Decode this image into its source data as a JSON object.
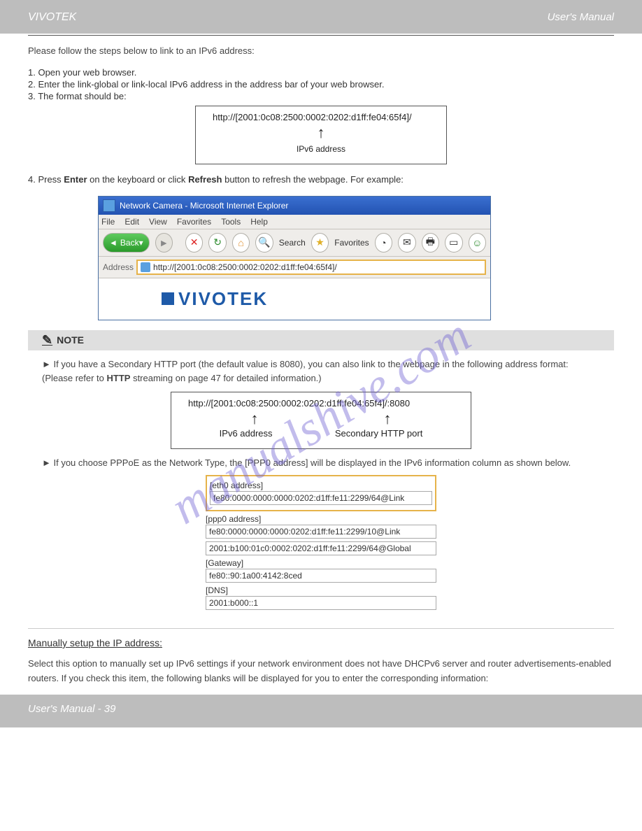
{
  "header": {
    "left": "VIVOTEK",
    "right": "User's Manual"
  },
  "intro": "Please follow the steps below to link to an IPv6 address:",
  "steps": {
    "s1": "1. Open your web browser.",
    "s2": "2. Enter the link-global or link-local IPv6 address in the address bar of your web browser.",
    "s3": "3. The format should be:"
  },
  "addr1": {
    "line": "http://[2001:0c08:2500:0002:0202:d1ff:fe04:65f4]/",
    "arrow": "↑",
    "sub": "IPv6 address"
  },
  "refer": "4. Press Enter on the keyboard or click Refresh button to refresh the webpage. For example:",
  "ie": {
    "title": "Network Camera - Microsoft Internet Explorer",
    "menus": [
      "File",
      "Edit",
      "View",
      "Favorites",
      "Tools",
      "Help"
    ],
    "back": "Back",
    "search": "Search",
    "favorites": "Favorites",
    "addr_label": "Address",
    "addr_value": "http://[2001:0c08:2500:0002:0202:d1ff:fe04:65f4]/",
    "logo": "VIVOTEK"
  },
  "note": {
    "label": "NOTE",
    "lead": "►  If you have a Secondary HTTP port (the default value is 8080), you can also link to the webpage in the following address format: (Please refer to HTTP streaming on page 47 for detailed information.)",
    "addr2": {
      "line": "http://[2001:0c08:2500:0002:0202:d1ff:fe04:65f4]/:8080",
      "left_sub": "IPv6 address",
      "right_sub": "Secondary HTTP port"
    },
    "lead2": "►  If you choose PPPoE as the Network Type, the [PPP0 address] will be displayed in the IPv6 information column as shown below.",
    "fields": {
      "eth0_label": "[eth0 address]",
      "eth0_val": "fe80:0000:0000:0000:0202:d1ff:fe11:2299/64@Link",
      "ppp0_label": "[ppp0 address]",
      "ppp0_val_a": "fe80:0000:0000:0000:0202:d1ff:fe11:2299/10@Link",
      "ppp0_val_b": "2001:b100:01c0:0002:0202:d1ff:fe11:2299/64@Global",
      "gw_label": "[Gateway]",
      "gw_val": "fe80::90:1a00:4142:8ced",
      "dns_label": "[DNS]",
      "dns_val": "2001:b000::1"
    }
  },
  "manual": {
    "title": "Manually setup the IP address:",
    "text": "Select this option to manually set up IPv6 settings if your network environment does not have DHCPv6 server and router advertisements-enabled routers. If you check this item, the following blanks will be displayed for you to enter the corresponding information:"
  },
  "footer": {
    "left": "User's Manual - 39",
    "right": ""
  },
  "watermark": "manualshive.com"
}
